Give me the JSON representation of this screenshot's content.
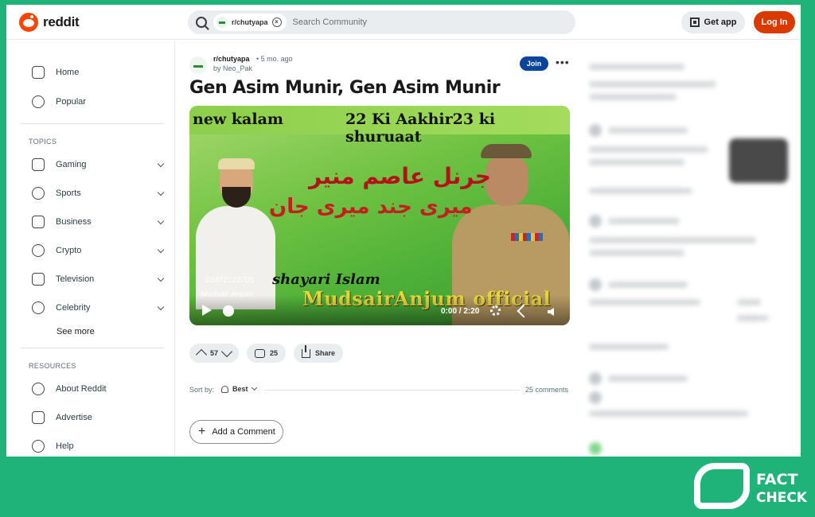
{
  "header": {
    "logo_text": "reddit",
    "search_chip": "r/chutyapa",
    "search_placeholder": "Search Community",
    "get_app_label": "Get app",
    "login_label": "Log In"
  },
  "sidebar": {
    "main": [
      {
        "label": "Home",
        "icon": "home-icon"
      },
      {
        "label": "Popular",
        "icon": "popular-icon"
      }
    ],
    "topics_title": "TOPICS",
    "topics": [
      {
        "label": "Gaming",
        "icon": "gamepad-icon"
      },
      {
        "label": "Sports",
        "icon": "sports-icon"
      },
      {
        "label": "Business",
        "icon": "chart-icon"
      },
      {
        "label": "Crypto",
        "icon": "crypto-icon"
      },
      {
        "label": "Television",
        "icon": "tv-icon"
      },
      {
        "label": "Celebrity",
        "icon": "star-icon"
      }
    ],
    "see_more": "See more",
    "resources_title": "RESOURCES",
    "resources": [
      {
        "label": "About Reddit",
        "icon": "reddit-icon"
      },
      {
        "label": "Advertise",
        "icon": "megaphone-icon"
      },
      {
        "label": "Help",
        "icon": "help-icon"
      }
    ]
  },
  "post": {
    "subreddit": "r/chutyapa",
    "age": "• 5 mo. ago",
    "author": "by Neo_Pak",
    "join_label": "Join",
    "more_label": "•••",
    "title": "Gen Asim Munir, Gen Asim Munir",
    "video": {
      "top_left_text": "new kalam",
      "top_right_text": "22 Ki Aakhir23 ki shuruaat",
      "urdu_line1": "جرنل عاصم منیر",
      "urdu_line2": "میری جند میری جان",
      "phone_text": "03472123705",
      "shayari_text": "shayari Islam",
      "anjum_text": "Mudsair Anjum",
      "official_text": "MudsairAnjum official",
      "time": "0:00 / 2:20",
      "progress": 0
    },
    "votes": "57",
    "comments": "25",
    "share_label": "Share",
    "sort_by_label": "Sort by:",
    "sort_value": "Best",
    "comments_count_label": "25 comments",
    "add_comment_label": "Add a Comment"
  },
  "watermark": {
    "line1": "FACT",
    "line2": "CHECK"
  },
  "colors": {
    "background": "#1fb37a",
    "login": "#d93a00",
    "join": "#0a449b",
    "reddit_orange": "#ff4500"
  }
}
